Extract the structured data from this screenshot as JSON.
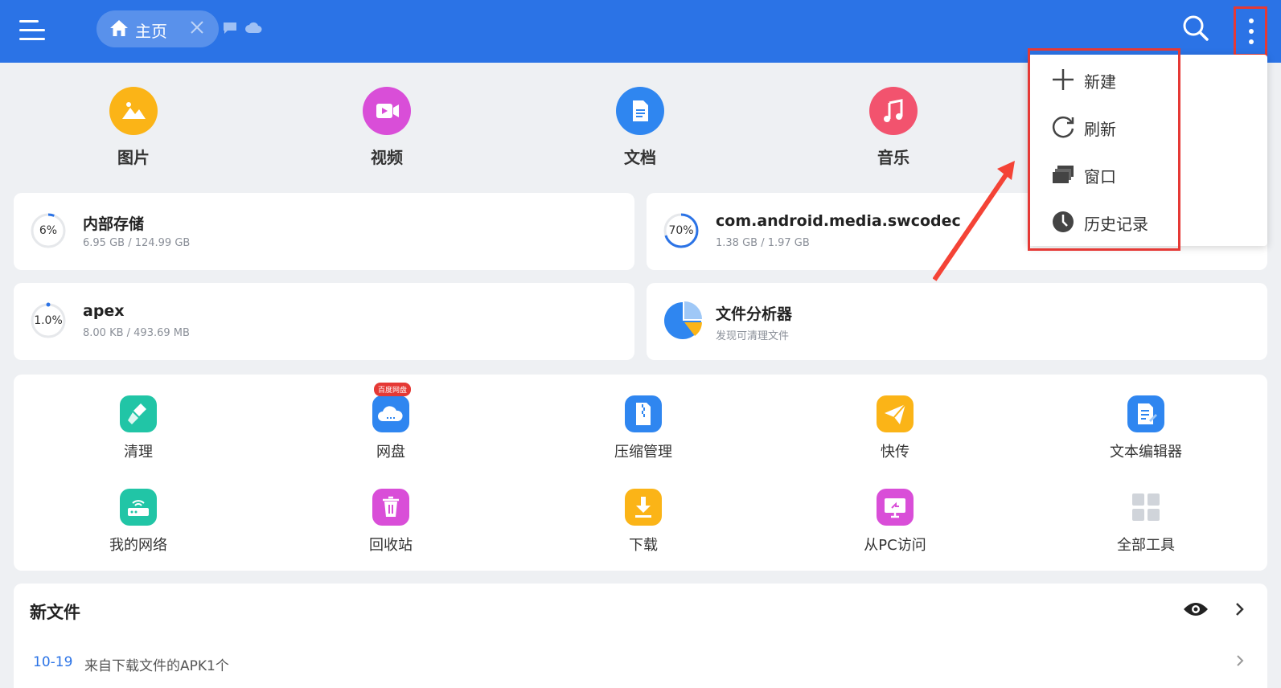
{
  "colors": {
    "topbar": "#2b73e6",
    "highlight": "#e53935"
  },
  "header": {
    "tab_label": "主页",
    "icons": [
      "menu-icon",
      "home-icon",
      "close-icon",
      "message-icon",
      "cloud-icon",
      "search-icon",
      "more-vertical-icon"
    ]
  },
  "categories": [
    {
      "label": "图片",
      "icon": "image-icon",
      "color": "#fbb417"
    },
    {
      "label": "视频",
      "icon": "video-icon",
      "color": "#d94ed8"
    },
    {
      "label": "文档",
      "icon": "document-icon",
      "color": "#2f86f0"
    },
    {
      "label": "音乐",
      "icon": "music-icon",
      "color": "#f2536e"
    }
  ],
  "storage": [
    {
      "title": "内部存储",
      "subtitle": "6.95 GB / 124.99 GB",
      "percent": "6%",
      "fraction": 0.06
    },
    {
      "title": "com.android.media.swcodec",
      "subtitle": "1.38 GB / 1.97 GB",
      "percent": "70%",
      "fraction": 0.7
    },
    {
      "title": "apex",
      "subtitle": "8.00 KB / 493.69 MB",
      "percent": "1.0%",
      "fraction": 0.01
    },
    {
      "title": "文件分析器",
      "subtitle": "发现可清理文件"
    }
  ],
  "tools": [
    {
      "label": "清理",
      "icon": "broom-icon",
      "color": "#21c5a6"
    },
    {
      "label": "网盘",
      "icon": "cloud-drive-icon",
      "color": "#2f86f0",
      "badge": "百度网盘"
    },
    {
      "label": "压缩管理",
      "icon": "zip-icon",
      "color": "#2f86f0"
    },
    {
      "label": "快传",
      "icon": "send-icon",
      "color": "#fbb417"
    },
    {
      "label": "文本编辑器",
      "icon": "text-edit-icon",
      "color": "#2f86f0"
    },
    {
      "label": "我的网络",
      "icon": "network-icon",
      "color": "#21c5a6"
    },
    {
      "label": "回收站",
      "icon": "trash-icon",
      "color": "#d94ed8"
    },
    {
      "label": "下载",
      "icon": "download-icon",
      "color": "#fbb417"
    },
    {
      "label": "从PC访问",
      "icon": "pc-access-icon",
      "color": "#d94ed8"
    },
    {
      "label": "全部工具",
      "icon": "grid-icon",
      "color": "#d0d4da"
    }
  ],
  "new_files": {
    "title": "新文件",
    "date": "10-19",
    "description": "来自下载文件的APK1个"
  },
  "menu": {
    "items": [
      {
        "label": "新建",
        "icon": "plus-icon"
      },
      {
        "label": "刷新",
        "icon": "refresh-icon"
      },
      {
        "label": "窗口",
        "icon": "windows-icon"
      },
      {
        "label": "历史记录",
        "icon": "history-icon"
      }
    ]
  }
}
